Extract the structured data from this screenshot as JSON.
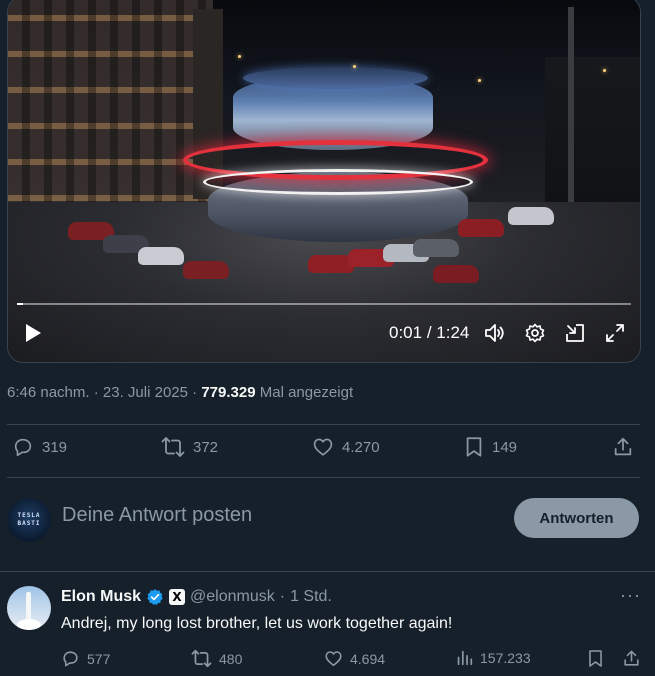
{
  "video": {
    "current_time": "0:01",
    "separator": " / ",
    "duration": "1:24",
    "progress_fraction": 0.01
  },
  "post_meta": {
    "time": "6:46 nachm.",
    "sep1": " · ",
    "date": "23. Juli 2025",
    "sep2": " · ",
    "views": "779.329",
    "views_label": " Mal angezeigt"
  },
  "actions": {
    "replies": "319",
    "reposts": "372",
    "likes": "4.270",
    "bookmarks": "149"
  },
  "composer": {
    "avatar_text_line1": "TESLA",
    "avatar_text_line2": "BASTI",
    "placeholder": "Deine Antwort posten",
    "reply_button": "Antworten"
  },
  "reply": {
    "name": "Elon Musk",
    "badge_letter": "X",
    "handle": "@elonmusk",
    "sep": " · ",
    "time": "1 Std.",
    "more": "···",
    "text": "Andrej, my long lost brother, let us work together again!",
    "replies": "577",
    "reposts": "480",
    "likes": "4.694",
    "views": "157.233"
  },
  "colors": {
    "background": "#15202b",
    "text_primary": "#f7f9f9",
    "text_secondary": "#8b98a5",
    "divider": "#38444d",
    "verified_blue": "#1d9bf0"
  },
  "icons": [
    "play-icon",
    "volume-icon",
    "settings-icon",
    "pip-icon",
    "fullscreen-icon",
    "reply-icon",
    "repost-icon",
    "like-icon",
    "bookmark-icon",
    "share-icon",
    "verified-icon",
    "views-icon"
  ]
}
